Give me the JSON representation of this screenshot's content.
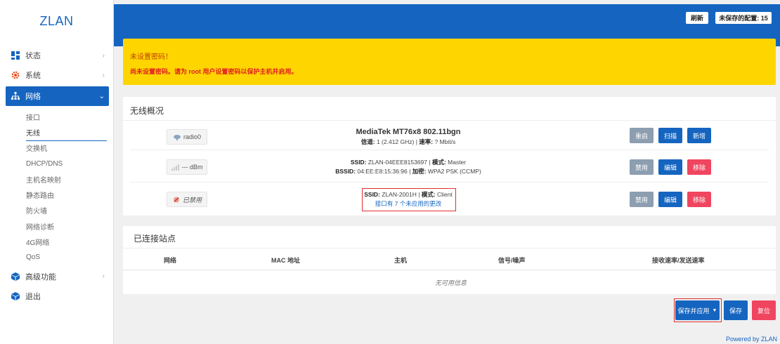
{
  "app": {
    "brand": "ZLAN"
  },
  "sidebar": {
    "items": [
      {
        "label": "状态",
        "icon": "dashboard-icon",
        "expanded": false
      },
      {
        "label": "系统",
        "icon": "gear-icon",
        "expanded": false
      },
      {
        "label": "网络",
        "icon": "network-icon",
        "expanded": true
      },
      {
        "label": "高级功能",
        "icon": "cube-icon",
        "expanded": false
      },
      {
        "label": "退出",
        "icon": "exit-icon",
        "expanded": false
      }
    ],
    "network_sub": [
      "接口",
      "无线",
      "交换机",
      "DHCP/DNS",
      "主机名映射",
      "静态路由",
      "防火墙",
      "网络诊断",
      "4G网络",
      "QoS"
    ],
    "current_sub": "无线"
  },
  "header": {
    "refresh_label": "刷新",
    "unsaved_label": "未保存的配置: 15"
  },
  "warning": {
    "title": "未设置密码！",
    "text": "尚未设置密码。请为 root 用户设置密码以保护主机并启用。"
  },
  "wireless": {
    "title": "无线概况",
    "rows": [
      {
        "badge": "radio0",
        "line1": "MediaTek MT76x8 802.11bgn",
        "line2_k1": "信道:",
        "line2_v1": " 1 (2.412 GHz) | ",
        "line2_k2": "速率:",
        "line2_v2": " ? Mbit/s",
        "btn1": "重启",
        "btn2": "扫描",
        "btn3": "新增"
      },
      {
        "badge": "--- dBm",
        "line1_k1": "SSID:",
        "line1_v1": " ZLAN-04EEE8153697 | ",
        "line1_k2": "模式:",
        "line1_v2": " Master",
        "line2_k1": "BSSID:",
        "line2_v1": " 04:EE:E8:15:36:96 | ",
        "line2_k2": "加密:",
        "line2_v2": " WPA2 PSK (CCMP)",
        "btn1": "禁用",
        "btn2": "编辑",
        "btn3": "移除"
      },
      {
        "badge": "已禁用",
        "line1_k1": "SSID:",
        "line1_v1": " ZLAN-2001H | ",
        "line1_k2": "模式:",
        "line1_v2": " Client",
        "line2": "接口有 7 个未应用的更改",
        "btn1": "禁用",
        "btn2": "编辑",
        "btn3": "移除"
      }
    ]
  },
  "stations": {
    "title": "已连接站点",
    "columns": [
      "网络",
      "MAC 地址",
      "主机",
      "信号/噪声",
      "接收速率/发送速率"
    ],
    "empty": "无可用信息"
  },
  "actions": {
    "save_apply": "保存并应用",
    "save": "保存",
    "reset": "复位"
  },
  "footer": "Powered by ZLAN",
  "colors": {
    "primary": "#1565c0",
    "warning": "#ffd500",
    "danger": "#f0455f",
    "neutral": "#8c9eb0"
  }
}
